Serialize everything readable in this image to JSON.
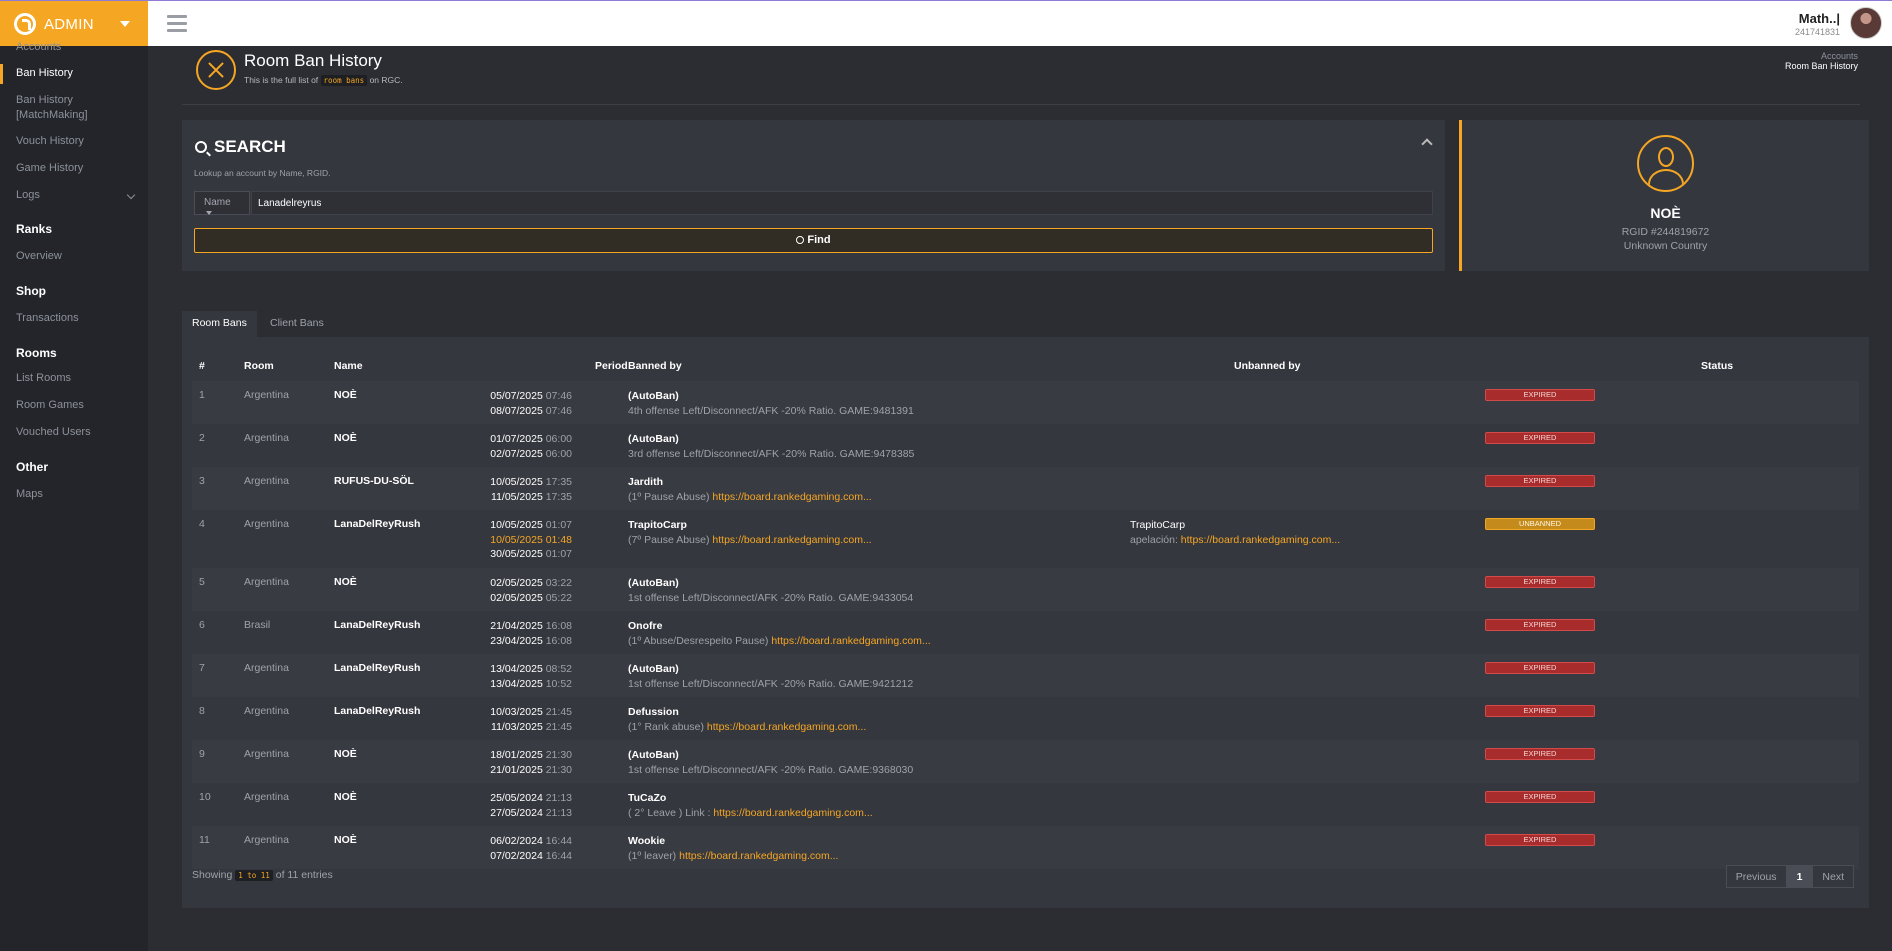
{
  "topbar": {
    "brand": "ADMIN",
    "user_name": "Math..|",
    "user_id": "241741831"
  },
  "sidebar": {
    "items": [
      {
        "label": "Accounts",
        "type": "item"
      },
      {
        "label": "Ban History",
        "type": "item",
        "active": true
      },
      {
        "label": "Ban History [MatchMaking]",
        "type": "item"
      },
      {
        "label": "Vouch History",
        "type": "item"
      },
      {
        "label": "Game History",
        "type": "item"
      },
      {
        "label": "Logs",
        "type": "item"
      },
      {
        "label": "Ranks",
        "type": "heading"
      },
      {
        "label": "Overview",
        "type": "item"
      },
      {
        "label": "Shop",
        "type": "heading"
      },
      {
        "label": "Transactions",
        "type": "item"
      },
      {
        "label": "Rooms",
        "type": "heading"
      },
      {
        "label": "List Rooms",
        "type": "item"
      },
      {
        "label": "Room Games",
        "type": "item"
      },
      {
        "label": "Vouched Users",
        "type": "item"
      },
      {
        "label": "Other",
        "type": "heading"
      },
      {
        "label": "Maps",
        "type": "item"
      }
    ]
  },
  "page": {
    "title": "Room Ban History",
    "subtitle_pre": "This is the full list of",
    "subtitle_code": "room bans",
    "subtitle_post": "on RGC.",
    "breadcrumb": [
      "Accounts",
      "Room Ban History"
    ]
  },
  "search": {
    "title": "SEARCH",
    "help": "Lookup an account by Name, RGID.",
    "type_label": "Name",
    "value": "Lanadelreyrus",
    "find_label": "Find"
  },
  "profile": {
    "name": "NOÈ",
    "rgid": "RGID #244819672",
    "country": "Unknown Country"
  },
  "tabs": [
    "Room Bans",
    "Client Bans"
  ],
  "table": {
    "headers": [
      "#",
      "Room",
      "Name",
      "Period",
      "Banned by",
      "Unbanned by",
      "Status"
    ],
    "rows": [
      {
        "num": "1",
        "room": "Argentina",
        "name": "NOÈ",
        "periods": [
          [
            "05/07/2025",
            "07:46"
          ],
          [
            "08/07/2025",
            "07:46"
          ]
        ],
        "by": "(AutoBan)",
        "reason": "4th offense Left/Disconnect/AFK -20% Ratio. GAME:9481391",
        "link": "",
        "unby": "",
        "unreason": "",
        "unlink": "",
        "status": "EXPIRED"
      },
      {
        "num": "2",
        "room": "Argentina",
        "name": "NOÈ",
        "periods": [
          [
            "01/07/2025",
            "06:00"
          ],
          [
            "02/07/2025",
            "06:00"
          ]
        ],
        "by": "(AutoBan)",
        "reason": "3rd offense Left/Disconnect/AFK -20% Ratio. GAME:9478385",
        "link": "",
        "unby": "",
        "unreason": "",
        "unlink": "",
        "status": "EXPIRED"
      },
      {
        "num": "3",
        "room": "Argentina",
        "name": "RUFUS-DU-SÖL",
        "periods": [
          [
            "10/05/2025",
            "17:35"
          ],
          [
            "11/05/2025",
            "17:35"
          ]
        ],
        "by": "Jardith",
        "reason": "(1º Pause Abuse)",
        "link": "https://board.rankedgaming.com...",
        "unby": "",
        "unreason": "",
        "unlink": "",
        "status": "EXPIRED"
      },
      {
        "num": "4",
        "room": "Argentina",
        "name": "LanaDelReyRush",
        "periods": [
          [
            "10/05/2025",
            "01:07"
          ],
          [
            "10/05/2025",
            "01:48"
          ],
          [
            "30/05/2025",
            "01:07"
          ]
        ],
        "by": "TrapitoCarp",
        "reason": "(7º Pause Abuse)",
        "link": "https://board.rankedgaming.com...",
        "unby": "TrapitoCarp",
        "unreason": "apelación:",
        "unlink": "https://board.rankedgaming.com...",
        "status": "UNBANNED"
      },
      {
        "num": "5",
        "room": "Argentina",
        "name": "NOÈ",
        "periods": [
          [
            "02/05/2025",
            "03:22"
          ],
          [
            "02/05/2025",
            "05:22"
          ]
        ],
        "by": "(AutoBan)",
        "reason": "1st offense Left/Disconnect/AFK -20% Ratio. GAME:9433054",
        "link": "",
        "unby": "",
        "unreason": "",
        "unlink": "",
        "status": "EXPIRED"
      },
      {
        "num": "6",
        "room": "Brasil",
        "name": "LanaDelReyRush",
        "periods": [
          [
            "21/04/2025",
            "16:08"
          ],
          [
            "23/04/2025",
            "16:08"
          ]
        ],
        "by": "Onofre",
        "reason": "(1º Abuse/Desrespeito Pause)",
        "link": "https://board.rankedgaming.com...",
        "unby": "",
        "unreason": "",
        "unlink": "",
        "status": "EXPIRED"
      },
      {
        "num": "7",
        "room": "Argentina",
        "name": "LanaDelReyRush",
        "periods": [
          [
            "13/04/2025",
            "08:52"
          ],
          [
            "13/04/2025",
            "10:52"
          ]
        ],
        "by": "(AutoBan)",
        "reason": "1st offense Left/Disconnect/AFK -20% Ratio. GAME:9421212",
        "link": "",
        "unby": "",
        "unreason": "",
        "unlink": "",
        "status": "EXPIRED"
      },
      {
        "num": "8",
        "room": "Argentina",
        "name": "LanaDelReyRush",
        "periods": [
          [
            "10/03/2025",
            "21:45"
          ],
          [
            "11/03/2025",
            "21:45"
          ]
        ],
        "by": "Defussion",
        "reason": "(1° Rank abuse)",
        "link": "https://board.rankedgaming.com...",
        "unby": "",
        "unreason": "",
        "unlink": "",
        "status": "EXPIRED"
      },
      {
        "num": "9",
        "room": "Argentina",
        "name": "NOÈ",
        "periods": [
          [
            "18/01/2025",
            "21:30"
          ],
          [
            "21/01/2025",
            "21:30"
          ]
        ],
        "by": "(AutoBan)",
        "reason": "1st offense Left/Disconnect/AFK -20% Ratio. GAME:9368030",
        "link": "",
        "unby": "",
        "unreason": "",
        "unlink": "",
        "status": "EXPIRED"
      },
      {
        "num": "10",
        "room": "Argentina",
        "name": "NOÈ",
        "periods": [
          [
            "25/05/2024",
            "21:13"
          ],
          [
            "27/05/2024",
            "21:13"
          ]
        ],
        "by": "TuCaZo",
        "reason": "( 2° Leave ) Link :",
        "link": "https://board.rankedgaming.com...",
        "unby": "",
        "unreason": "",
        "unlink": "",
        "status": "EXPIRED"
      },
      {
        "num": "11",
        "room": "Argentina",
        "name": "NOÈ",
        "periods": [
          [
            "06/02/2024",
            "16:44"
          ],
          [
            "07/02/2024",
            "16:44"
          ]
        ],
        "by": "Wookie",
        "reason": "(1º leaver)",
        "link": "https://board.rankedgaming.com...",
        "unby": "",
        "unreason": "",
        "unlink": "",
        "status": "EXPIRED"
      }
    ]
  },
  "footer": {
    "showing_pre": "Showing",
    "showing_code": "1 to 11",
    "showing_post": "of 11 entries",
    "prev": "Previous",
    "page": "1",
    "next": "Next"
  }
}
